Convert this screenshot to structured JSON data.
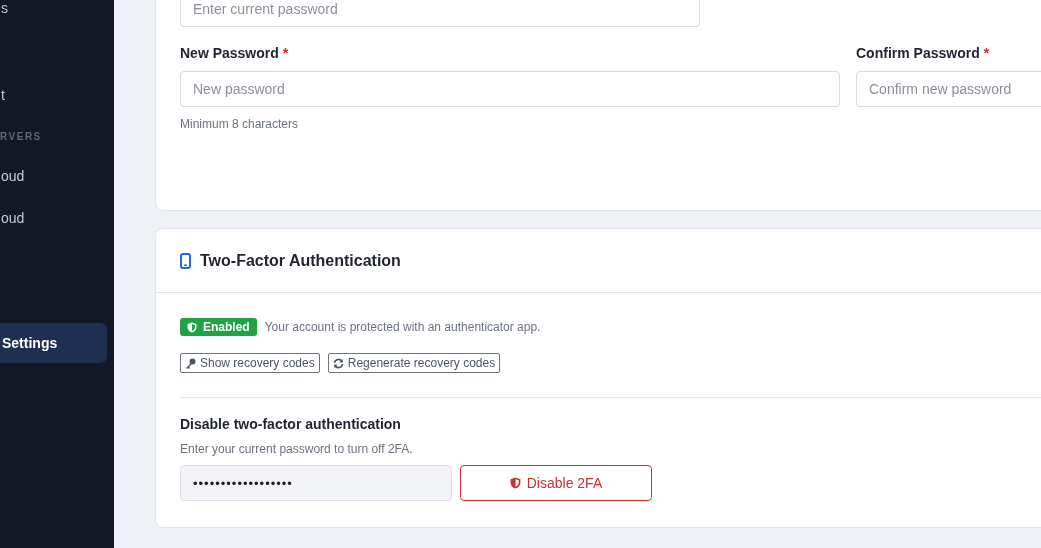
{
  "sidebar": {
    "items": [
      {
        "label": "s",
        "kind": "item",
        "selected": false
      },
      {
        "label": "t",
        "kind": "item",
        "selected": false
      },
      {
        "label": "RVERS",
        "kind": "section"
      },
      {
        "label": "oud",
        "kind": "item",
        "selected": false
      },
      {
        "label": "oud",
        "kind": "item",
        "selected": false
      },
      {
        "label": "Settings",
        "kind": "item",
        "selected": true
      }
    ]
  },
  "password_card": {
    "current_password": {
      "placeholder": "Enter current password"
    },
    "new_password": {
      "label": "New Password",
      "required_mark": "*",
      "placeholder": "New password",
      "hint": "Minimum 8 characters"
    },
    "confirm_password": {
      "label": "Confirm Password",
      "required_mark": "*",
      "placeholder": "Confirm new password"
    }
  },
  "two_factor_card": {
    "title": "Two-Factor Authentication",
    "enabled": true,
    "status_label": "Enabled",
    "status_text": "Your account is protected with an authenticator app.",
    "buttons": [
      "Show recovery codes",
      "Regenerate recovery codes"
    ],
    "disable_title": "Disable two-factor authentication",
    "disable_text": "Enter your current password to turn off 2FA.",
    "password_value": "••••••••••••••••••",
    "disable_button": "Disable 2FA"
  }
}
